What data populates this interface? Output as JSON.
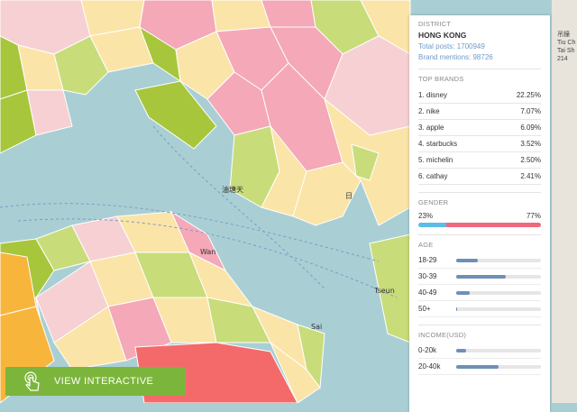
{
  "map": {
    "labels": [
      "油塘天",
      "日",
      "Wan",
      "Sai",
      "Tseun"
    ]
  },
  "right_edge": {
    "lines": [
      "吊鐘",
      "Tiu Ch",
      "Tai Sh",
      "214"
    ]
  },
  "panel": {
    "district_title": "DISTRICT",
    "district_name": "HONG KONG",
    "total_posts": "Total posts: 1700949",
    "brand_mentions": "Brand mentions: 98726",
    "top_brands_title": "TOP BRANDS",
    "brands": [
      {
        "name": "1. disney",
        "pct": "22.25%"
      },
      {
        "name": "2. nike",
        "pct": "7.07%"
      },
      {
        "name": "3. apple",
        "pct": "6.09%"
      },
      {
        "name": "4. starbucks",
        "pct": "3.52%"
      },
      {
        "name": "5. michelin",
        "pct": "2.50%"
      },
      {
        "name": "6. cathay",
        "pct": "2.41%"
      }
    ],
    "gender_title": "GENDER",
    "gender_left": "23%",
    "gender_right": "77%",
    "gender_left_fraction": 0.23,
    "gender_colors": {
      "left": "#5bbde6",
      "right": "#ee6a7c"
    },
    "age_title": "AGE",
    "ages": [
      {
        "label": "18-29",
        "fraction": 0.25
      },
      {
        "label": "30-39",
        "fraction": 0.58
      },
      {
        "label": "40-49",
        "fraction": 0.16
      },
      {
        "label": "50+",
        "fraction": 0.01
      }
    ],
    "income_title": "INCOME(USD)",
    "incomes": [
      {
        "label": "0-20k",
        "fraction": 0.12
      },
      {
        "label": "20-40k",
        "fraction": 0.5
      }
    ]
  },
  "cta": {
    "label": "VIEW INTERACTIVE",
    "color": "#7cb53b"
  }
}
